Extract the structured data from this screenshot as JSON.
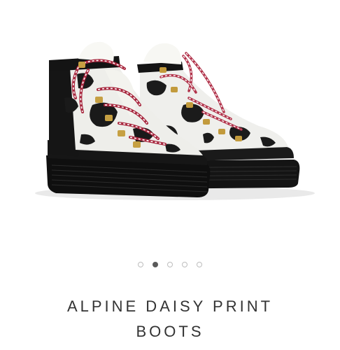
{
  "product": {
    "title_line1": "ALPINE DAISY PRINT",
    "title_line2": "BOOTS",
    "image_alt": "Pair of high-top lace-up boots with black and white cow print pony hair, white shearling collar, red and white rope laces and black platform soles"
  },
  "gallery": {
    "slide_count": 5,
    "active_index": 1,
    "indicator_icon": "carousel-dot"
  },
  "colors": {
    "background": "#ffffff",
    "title_text": "#333333",
    "dot_active": "#5a5a5a",
    "dot_inactive": "#bdbdbd"
  }
}
